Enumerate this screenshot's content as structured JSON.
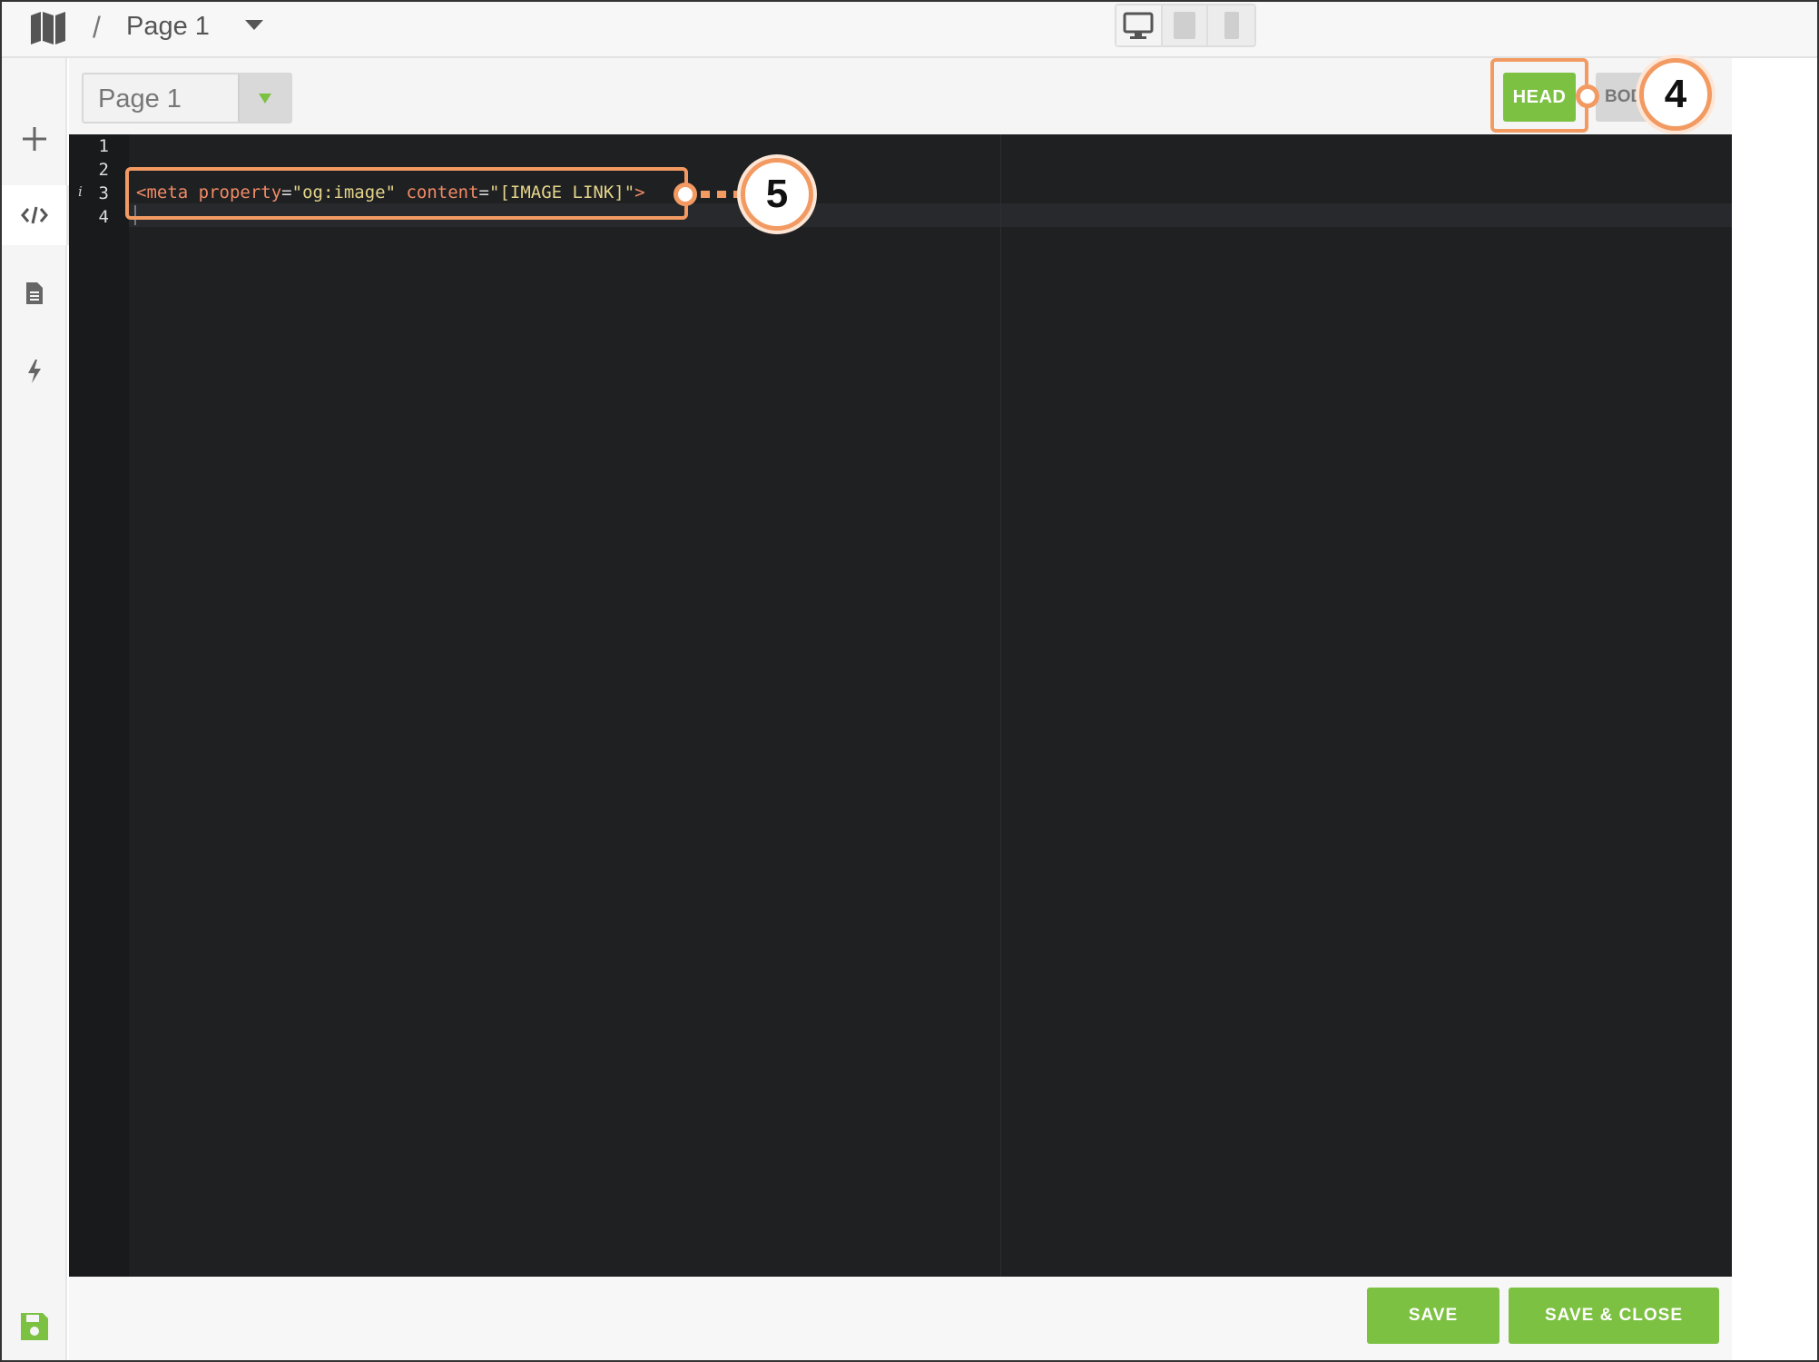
{
  "breadcrumb": {
    "separator": "/",
    "page": "Page 1"
  },
  "devices": [
    "desktop",
    "tablet",
    "phone"
  ],
  "rail": {
    "items": [
      "add",
      "code",
      "page",
      "actions"
    ],
    "active": "code"
  },
  "page_select": {
    "value": "Page 1"
  },
  "mode_tabs": {
    "head": "HEAD",
    "body": "BOD"
  },
  "editor": {
    "line_numbers": [
      "1",
      "2",
      "3",
      "4"
    ],
    "info_marker": "i",
    "code_line_3": {
      "open": "<meta",
      "attr1": "property",
      "eq": "=",
      "val1": "\"og:image\"",
      "attr2": "content",
      "val2": "\"[IMAGE LINK]\"",
      "close": ">"
    }
  },
  "footer": {
    "save": "SAVE",
    "save_close": "SAVE & CLOSE"
  },
  "annotations": {
    "step4": "4",
    "step5": "5"
  },
  "colors": {
    "accent_green": "#7dc143",
    "annotation_orange": "#f29a62",
    "editor_bg": "#1f2022"
  }
}
